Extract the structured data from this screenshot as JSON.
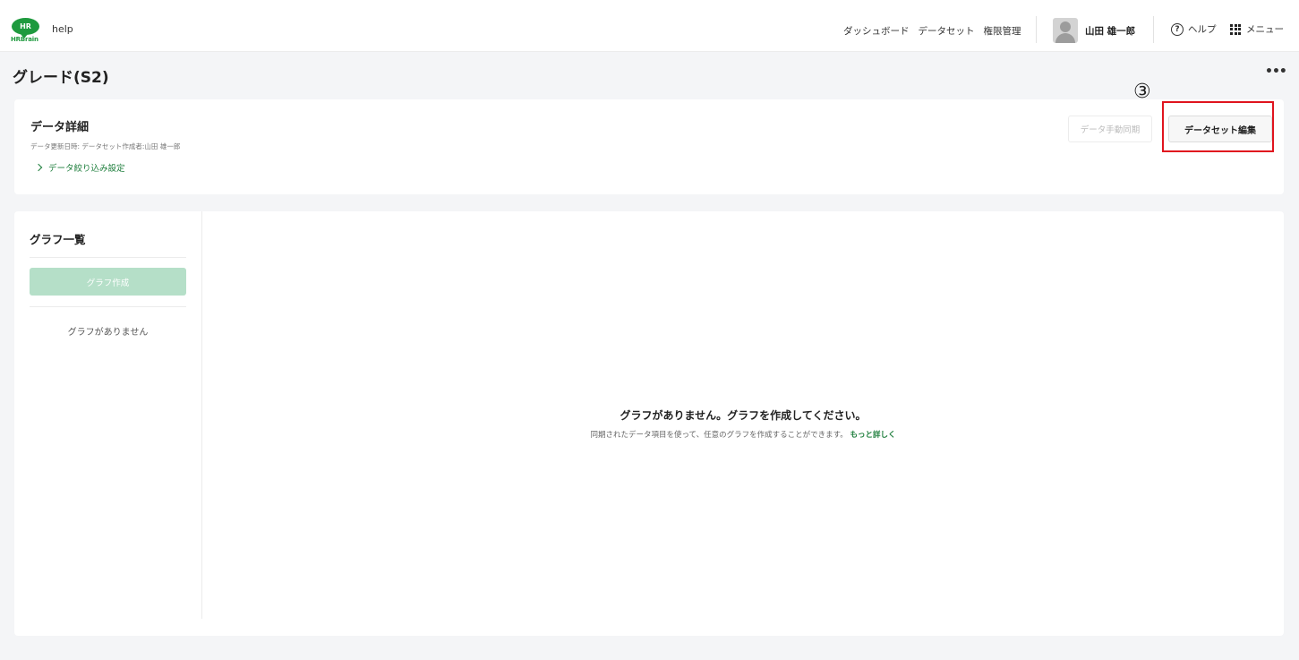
{
  "header": {
    "logo_mark": "HR",
    "logo_text": "HRBrain",
    "app_name": "help",
    "nav": [
      "ダッシュボード",
      "データセット",
      "権限管理"
    ],
    "user_name": "山田 雄一郎",
    "help_label": "ヘルプ",
    "menu_label": "メニュー"
  },
  "page": {
    "title": "グレード(S2)"
  },
  "detail": {
    "title": "データ詳細",
    "meta": "データ更新日時:  データセット作成者:山田 雄一郎",
    "filter_label": "データ絞り込み設定",
    "sync_button": "データ手動同期",
    "edit_button": "データセット編集"
  },
  "annotation": {
    "number": "③",
    "color": "#e0141e"
  },
  "graphs": {
    "title": "グラフ一覧",
    "create_button": "グラフ作成",
    "empty_side": "グラフがありません",
    "empty_title": "グラフがありません。グラフを作成してください。",
    "empty_desc": "同期されたデータ項目を使って、任意のグラフを作成することができます。",
    "learn_more": "もっと詳しく"
  },
  "colors": {
    "brand_green": "#1e9a3e",
    "link_green": "#1e7e3c",
    "create_button_bg": "#b5dfc8"
  }
}
